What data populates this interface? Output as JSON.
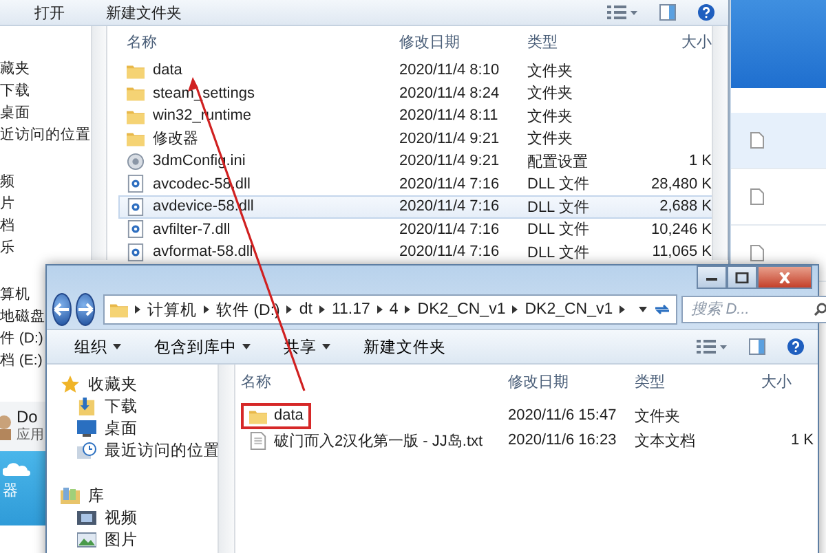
{
  "back_window": {
    "toolbar": [
      "打开",
      "新建文件夹"
    ],
    "sidebar": [
      "藏夹",
      "下载",
      "桌面",
      "近访问的位置",
      "频",
      "片",
      "档",
      "乐",
      "算机",
      "地磁盘",
      "件 (D:)",
      "档 (E:)"
    ],
    "columns": [
      "名称",
      "修改日期",
      "类型",
      "大小"
    ],
    "files": [
      {
        "name": "data",
        "date": "2020/11/4 8:10",
        "type": "文件夹",
        "kind": "folder",
        "selected": false
      },
      {
        "name": "steam_settings",
        "date": "2020/11/4 8:24",
        "type": "文件夹",
        "kind": "folder",
        "selected": false
      },
      {
        "name": "win32_runtime",
        "date": "2020/11/4 8:11",
        "type": "文件夹",
        "kind": "folder",
        "selected": false
      },
      {
        "name": "修改器",
        "date": "2020/11/4 9:21",
        "type": "文件夹",
        "kind": "folder",
        "selected": false
      },
      {
        "name": "3dmConfig.ini",
        "date": "2020/11/4 9:21",
        "type": "配置设置",
        "size": "1 K",
        "kind": "ini",
        "selected": false
      },
      {
        "name": "avcodec-58.dll",
        "date": "2020/11/4 7:16",
        "type": "DLL 文件",
        "size": "28,480 K",
        "kind": "dll",
        "selected": false
      },
      {
        "name": "avdevice-58.dll",
        "date": "2020/11/4 7:16",
        "type": "DLL 文件",
        "size": "2,688 K",
        "kind": "dll",
        "selected": true
      },
      {
        "name": "avfilter-7.dll",
        "date": "2020/11/4 7:16",
        "type": "DLL 文件",
        "size": "10,246 K",
        "kind": "dll",
        "selected": false
      },
      {
        "name": "avformat-58.dll",
        "date": "2020/11/4 7:16",
        "type": "DLL 文件",
        "size": "11,065 K",
        "kind": "dll",
        "selected": false
      }
    ]
  },
  "side_app": {
    "title": "Do",
    "subtitle": "应用",
    "label": "器"
  },
  "front_window": {
    "path": [
      "计算机",
      "软件 (D:)",
      "dt",
      "11.17",
      "4",
      "DK2_CN_v1",
      "DK2_CN_v1"
    ],
    "search": {
      "placeholder": "搜索 D..."
    },
    "toolbar": [
      {
        "label": "组织",
        "dropdown": true
      },
      {
        "label": "包含到库中",
        "dropdown": true
      },
      {
        "label": "共享",
        "dropdown": true
      },
      {
        "label": "新建文件夹",
        "dropdown": false
      }
    ],
    "sidebar": [
      {
        "label": "收藏夹",
        "kind": "star",
        "children": [
          {
            "label": "下载",
            "kind": "download"
          },
          {
            "label": "桌面",
            "kind": "desktop"
          },
          {
            "label": "最近访问的位置",
            "kind": "recent"
          }
        ]
      },
      {
        "label": "库",
        "kind": "library",
        "children": [
          {
            "label": "视频",
            "kind": "video"
          },
          {
            "label": "图片",
            "kind": "picture"
          }
        ]
      }
    ],
    "columns": [
      "名称",
      "修改日期",
      "类型",
      "大小"
    ],
    "files": [
      {
        "name": "data",
        "date": "2020/11/6 15:47",
        "type": "文件夹",
        "kind": "folder",
        "highlighted": true
      },
      {
        "name": "破门而入2汉化第一版 - JJ岛.txt",
        "date": "2020/11/6 16:23",
        "type": "文本文档",
        "size": "1 K",
        "kind": "txt",
        "highlighted": false
      }
    ]
  }
}
